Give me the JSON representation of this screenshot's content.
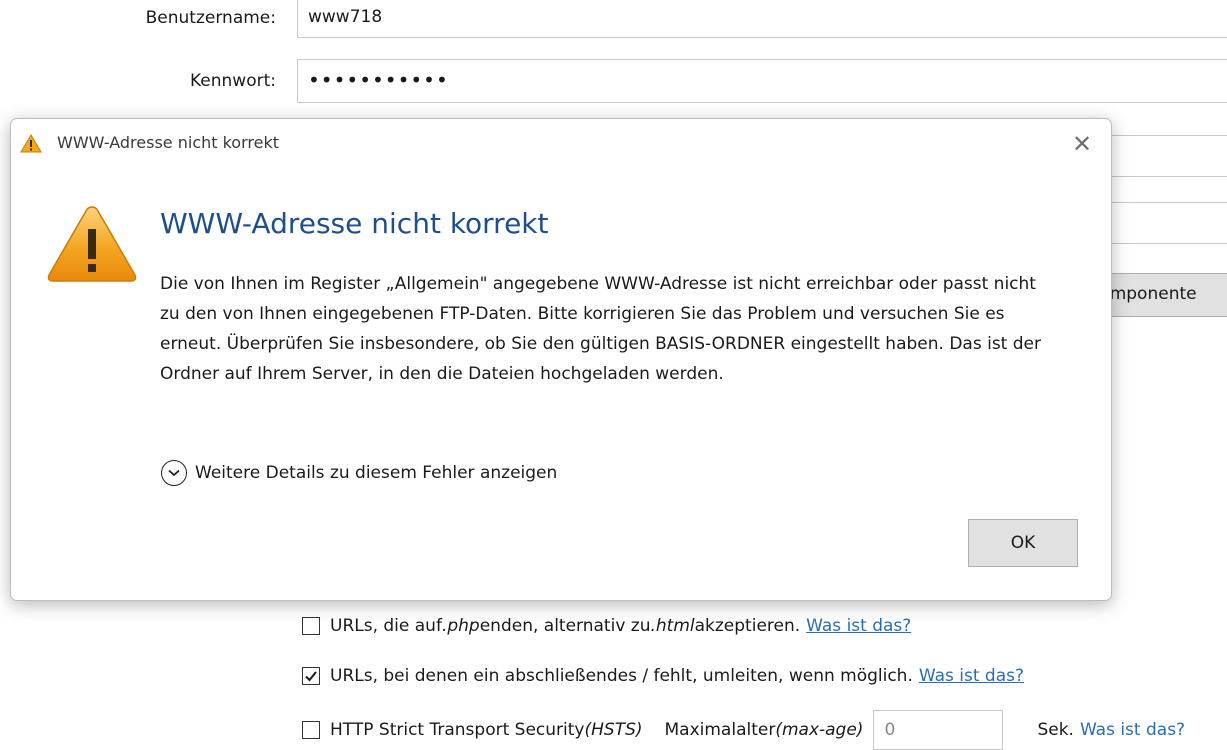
{
  "background_form": {
    "username_label": "Benutzername:",
    "username_value": "www718",
    "password_label": "Kennwort:",
    "password_value": "•••••••••••",
    "components_button": "Komponente",
    "options": [
      {
        "checked": false,
        "text_1": "URLs, die auf ",
        "em_1": ".php",
        "text_2": " enden, alternativ zu ",
        "em_2": ".html",
        "text_3": " akzeptieren.",
        "link": "Was ist das?"
      },
      {
        "checked": true,
        "text_1": "URLs, bei denen ein abschließendes / fehlt, umleiten, wenn möglich.",
        "link": "Was ist das?"
      },
      {
        "checked": false,
        "text_1": "HTTP Strict Transport Security ",
        "em_1": "(HSTS)",
        "maxage_label": "Maximalalter ",
        "maxage_em": "(max-age)",
        "maxage_value": "0",
        "unit": "Sek.",
        "link": "Was ist das?"
      }
    ]
  },
  "dialog": {
    "title": "WWW-Adresse nicht korrekt",
    "heading": "WWW-Adresse nicht korrekt",
    "message": "Die von Ihnen im Register „Allgemein\" angegebene WWW-Adresse ist nicht erreichbar oder passt nicht zu den von Ihnen eingegebenen FTP-Daten. Bitte korrigieren Sie das Problem und versuchen Sie es erneut. Überprüfen Sie insbesondere, ob Sie den gültigen BASIS-ORDNER eingestellt haben. Das ist der Ordner auf Ihrem Server, in den die Dateien hochgeladen werden.",
    "details_label": "Weitere Details zu diesem Fehler anzeigen",
    "ok_label": "OK",
    "close_symbol": "✕",
    "icons": [
      "warning-icon",
      "close-icon",
      "chevron-down-icon"
    ]
  },
  "colors": {
    "heading": "#1e4e8c",
    "link": "#2a6db5",
    "warning_fill": "#f5a623"
  }
}
